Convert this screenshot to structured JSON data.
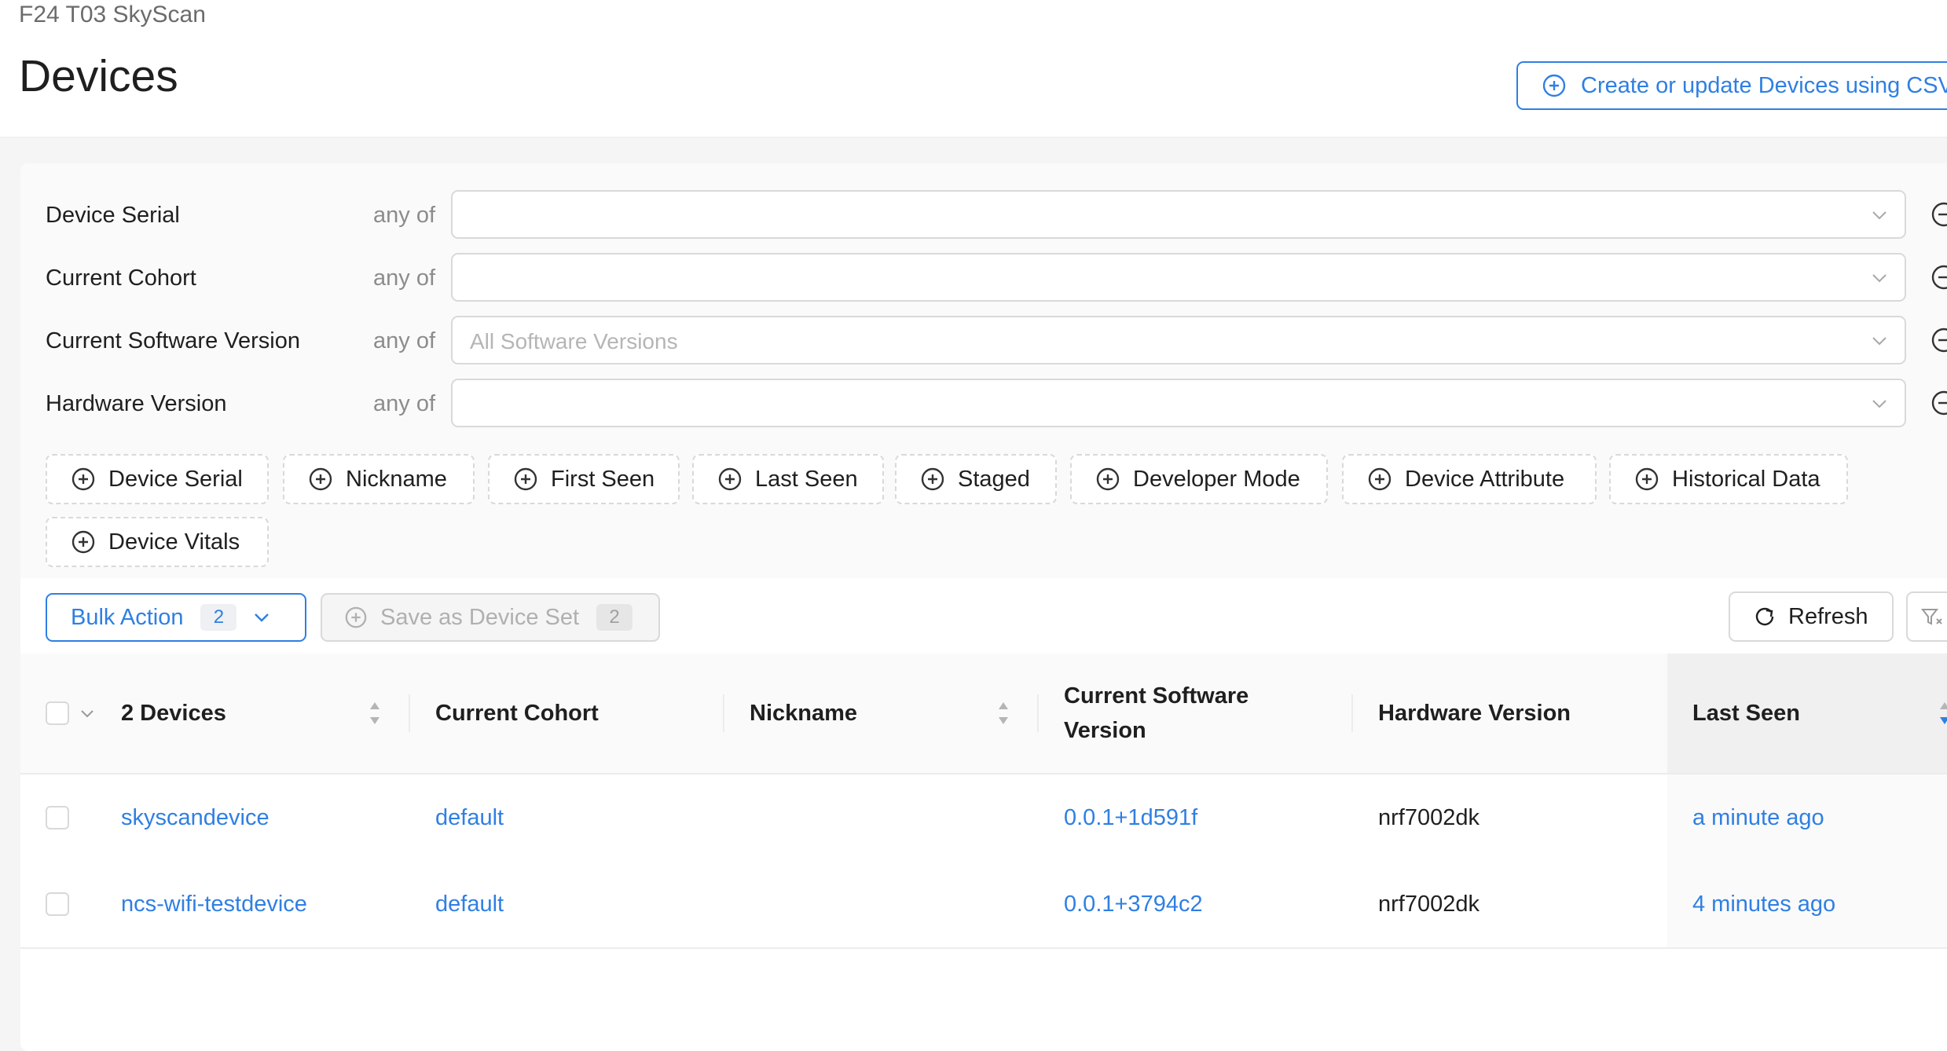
{
  "header": {
    "project_name": "F24 T03 SkyScan",
    "title": "Devices",
    "csv_button_label": "Create or update Devices using CSV"
  },
  "filters": [
    {
      "label": "Device Serial",
      "operator": "any of",
      "placeholder": ""
    },
    {
      "label": "Current Cohort",
      "operator": "any of",
      "placeholder": ""
    },
    {
      "label": "Current Software Version",
      "operator": "any of",
      "placeholder": "All Software Versions"
    },
    {
      "label": "Hardware Version",
      "operator": "any of",
      "placeholder": ""
    }
  ],
  "add_filter_chips": [
    "Device Serial",
    "Nickname",
    "First Seen",
    "Last Seen",
    "Staged",
    "Developer Mode",
    "Device Attribute",
    "Historical Data",
    "Device Vitals"
  ],
  "toolbar": {
    "bulk_action_label": "Bulk Action",
    "bulk_action_count": "2",
    "save_set_label": "Save as Device Set",
    "save_set_count": "2",
    "refresh_label": "Refresh"
  },
  "table": {
    "columns": {
      "devices": "2 Devices",
      "cohort": "Current Cohort",
      "nickname": "Nickname",
      "software_line1": "Current Software",
      "software_line2": "Version",
      "hardware": "Hardware Version",
      "last_seen": "Last Seen"
    },
    "rows": [
      {
        "serial": "skyscandevice",
        "cohort": "default",
        "nickname": "",
        "software": "0.0.1+1d591f",
        "hardware": "nrf7002dk",
        "last_seen": "a minute ago"
      },
      {
        "serial": "ncs-wifi-testdevice",
        "cohort": "default",
        "nickname": "",
        "software": "0.0.1+3794c2",
        "hardware": "nrf7002dk",
        "last_seen": "4 minutes ago"
      }
    ]
  },
  "colors": {
    "accent": "#2f7fe3",
    "border": "#d9d9d9",
    "muted_text": "#8c8c8c"
  }
}
